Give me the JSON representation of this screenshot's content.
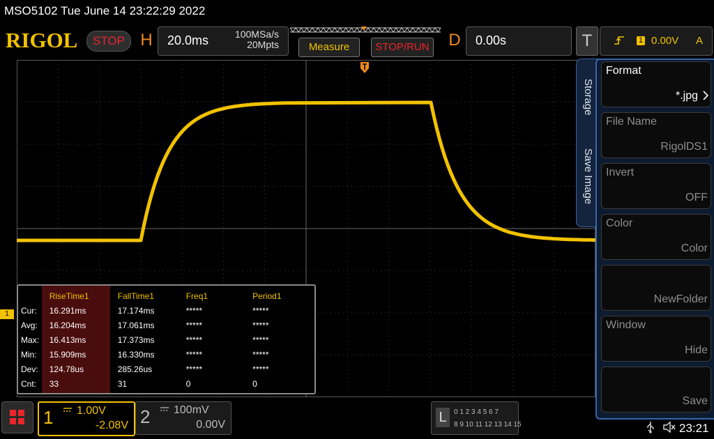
{
  "status_line": "MSO5102  Tue June 14 23:22:29 2022",
  "logo": "RIGOL",
  "run_state": "STOP",
  "horizontal": {
    "letter": "H",
    "timebase": "20.0ms",
    "sample_rate": "100MSa/s",
    "memory_depth": "20Mpts"
  },
  "buttons": {
    "measure": "Measure",
    "stop_run": "STOP/RUN"
  },
  "delay": {
    "letter": "D",
    "value": "0.00s"
  },
  "trigger": {
    "letter": "T",
    "channel": "1",
    "level": "0.00V",
    "mode": "A",
    "edge_icon": "rising-edge-icon"
  },
  "measure_table": {
    "headers": [
      "RiseTime1",
      "FallTime1",
      "Freq1",
      "Period1"
    ],
    "rows": [
      {
        "label": "Cur:",
        "values": [
          "16.291ms",
          "17.174ms",
          "*****",
          "*****"
        ]
      },
      {
        "label": "Avg:",
        "values": [
          "16.204ms",
          "17.061ms",
          "*****",
          "*****"
        ]
      },
      {
        "label": "Max:",
        "values": [
          "16.413ms",
          "17.373ms",
          "*****",
          "*****"
        ]
      },
      {
        "label": "Min:",
        "values": [
          "15.909ms",
          "16.330ms",
          "*****",
          "*****"
        ]
      },
      {
        "label": "Dev:",
        "values": [
          "124.78us",
          "285.26us",
          "*****",
          "*****"
        ]
      },
      {
        "label": "Cnt:",
        "values": [
          "33",
          "31",
          "0",
          "0"
        ]
      }
    ]
  },
  "ch1_marker": "1",
  "side_menu": {
    "tabs": [
      "Storage",
      "Save Image"
    ],
    "items": [
      {
        "title": "Format",
        "value": "*.jpg",
        "enabled": true
      },
      {
        "title": "File Name",
        "value": "RigolDS1",
        "enabled": false
      },
      {
        "title": "Invert",
        "value": "OFF",
        "enabled": false
      },
      {
        "title": "Color",
        "value": "Color",
        "enabled": false
      },
      {
        "title": "",
        "value": "NewFolder",
        "enabled": false
      },
      {
        "title": "Window",
        "value": "Hide",
        "enabled": false
      },
      {
        "title": "",
        "value": "Save",
        "enabled": false
      }
    ]
  },
  "channels": [
    {
      "num": "1",
      "scale": "1.00V",
      "offset": "-2.08V",
      "color": "#f2c200"
    },
    {
      "num": "2",
      "scale": "100mV",
      "offset": "0.00V",
      "color": "#bbbbbb"
    }
  ],
  "digital": {
    "letter": "L",
    "row1": "0 1 2 3  4 5 6 7",
    "row2": "8 9 10 11 12 13 14 15"
  },
  "clock": "23:21",
  "colors": {
    "ch1": "#f2c200",
    "accent_orange": "#f08a1c",
    "stop_red": "#e8262c",
    "menu_blue": "#3a66aa"
  }
}
